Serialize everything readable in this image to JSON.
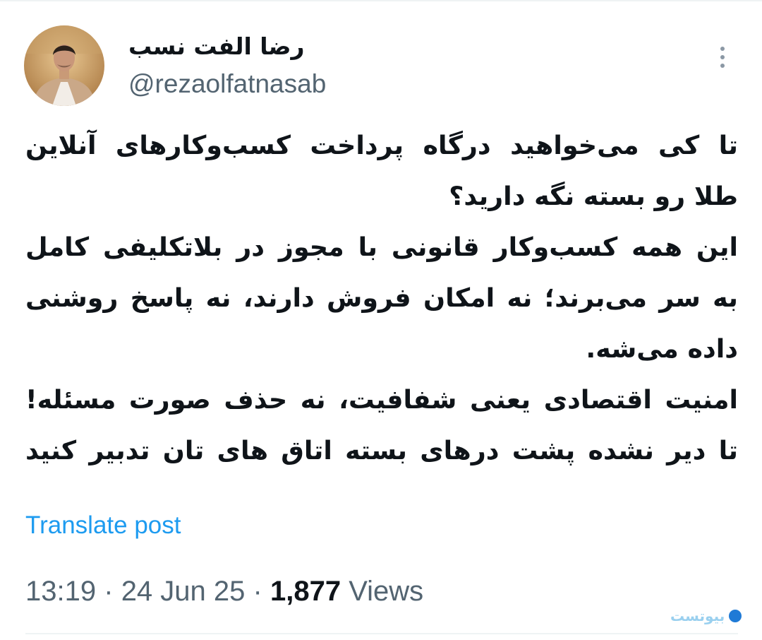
{
  "user": {
    "display_name": "رضا الفت نسب",
    "handle": "@rezaolfatnasab"
  },
  "tweet": {
    "lines": [
      "تا کی می‌خواهید درگاه پرداخت کسب‌وکارهای آنلاین",
      "طلا رو بسته نگه دارید؟",
      "این همه کسب‌وکار قانونی با مجوز در بلاتکلیفی کامل",
      "به سر می‌برند؛ نه امکان فروش دارند، نه پاسخ روشنی",
      "داده می‌شه.",
      "امنیت اقتصادی یعنی شفافیت، نه حذف صورت مسئله!",
      "تا دیر نشده پشت درهای بسته اتاق های تان تدبیر کنید"
    ]
  },
  "actions": {
    "translate_label": "Translate post",
    "more_icon": "more-vertical-icon"
  },
  "meta": {
    "time": "13:19",
    "separator": "·",
    "date": "24 Jun 25",
    "views_count": "1,877",
    "views_label": "Views"
  },
  "watermark": {
    "text": "بیوتست"
  },
  "colors": {
    "text": "#0f1419",
    "secondary": "#536471",
    "link": "#1d9bf0",
    "divider": "#eff3f4"
  }
}
